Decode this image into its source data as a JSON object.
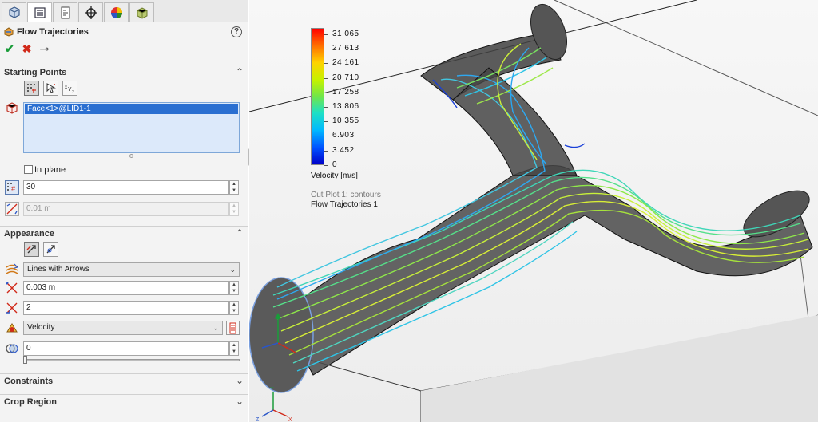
{
  "panel": {
    "tabs": [
      {
        "name": "feature-manager",
        "active": false
      },
      {
        "name": "property-manager",
        "active": true
      },
      {
        "name": "configuration-manager",
        "active": false
      },
      {
        "name": "dimxpert-manager",
        "active": false
      },
      {
        "name": "display-manager",
        "active": false
      },
      {
        "name": "flow-analysis",
        "active": false
      }
    ],
    "title": "Flow Trajectories",
    "help": "?",
    "ok_glyph": "✔",
    "cancel_glyph": "✖",
    "pin_glyph": "⊸",
    "starting_points": {
      "label": "Starting Points",
      "selected_face": "Face<1>@LID1-1",
      "in_plane_label": "In plane",
      "in_plane_checked": false,
      "number_of_points": "30",
      "offset": "0.01 m"
    },
    "appearance": {
      "label": "Appearance",
      "draw_style": "Lines with Arrows",
      "width": "0.003 m",
      "arrow_size": "2",
      "color_by": "Velocity",
      "transparency": "0",
      "transparency_fraction": 0
    },
    "constraints_label": "Constraints",
    "crop_region_label": "Crop Region",
    "colors": {
      "accent": "#2a6fd1",
      "check": "#1a9c3a",
      "cancel": "#d12a1a"
    }
  },
  "legend": {
    "values": [
      "31.065",
      "27.613",
      "24.161",
      "20.710",
      "17.258",
      "13.806",
      "10.355",
      "6.903",
      "3.452",
      "0"
    ],
    "units": "Velocity [m/s]",
    "cut_plot": "Cut Plot 1: contours",
    "flow_trajectories": "Flow Trajectories 1"
  }
}
